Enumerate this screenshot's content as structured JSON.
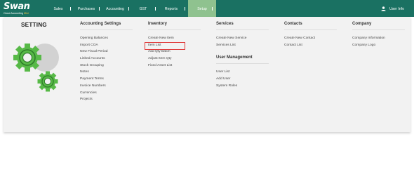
{
  "brand": {
    "name": "Swan",
    "tagline_pre": "Cloud Accounting ",
    "tagline_hl": "Mini"
  },
  "nav": {
    "items": [
      "Sales",
      "Purchases",
      "Accounting",
      "GST",
      "Reports",
      "Setup"
    ],
    "active": "Setup",
    "user_label": "User Info"
  },
  "page": {
    "title": "SETTING"
  },
  "columns": [
    {
      "heading": "Accounting Settings",
      "links": [
        "Opening Balances",
        "Import COA",
        "New Fiscal Period",
        "Linked Accounts",
        "Stock Grouping",
        "Notes",
        "Payment Terms",
        "Invoice Numbers",
        "Currencies",
        "Projects"
      ]
    },
    {
      "heading": "Inventory",
      "links": [
        "Create New Item",
        "Item List",
        "Add Qty Batch",
        "Adjust Item Qty",
        "Fixed Asset List"
      ],
      "highlighted": "Item List"
    },
    {
      "heading": "Services",
      "links": [
        "Create New Service",
        "Services List"
      ],
      "subheading": "User Management",
      "sublinks": [
        "User List",
        "Add User",
        "System Roles"
      ]
    },
    {
      "heading": "Contacts",
      "links": [
        "Create New Contact",
        "Contact List"
      ]
    },
    {
      "heading": "Company",
      "links": [
        "Company Information",
        "Company Logo"
      ]
    }
  ],
  "colors": {
    "topbar": "#1a7162",
    "active_tab": "#8fc28f",
    "gear_green": "#57b947",
    "gear_gray": "#cfcfcf",
    "highlight": "#e03b3b"
  },
  "icons": [
    "user-icon",
    "gear-icon"
  ]
}
